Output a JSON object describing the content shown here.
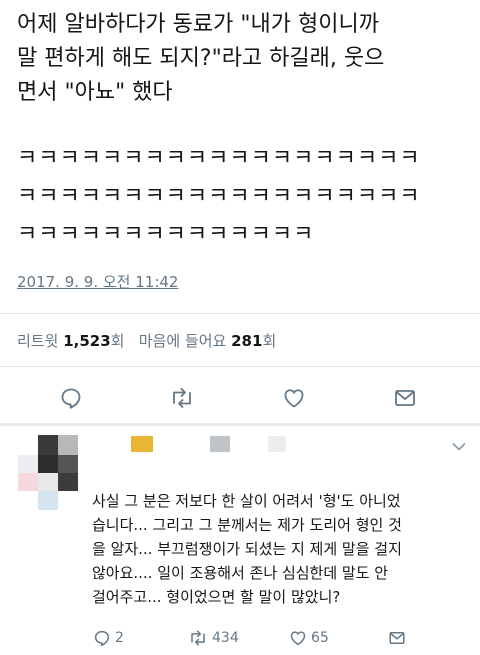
{
  "tweet": {
    "text_lines": [
      "어제 알바하다가 동료가 \"내가 형이니까",
      "말 편하게 해도 되지?\"라고 하길래, 웃으",
      "면서 \"아뇨\" 했다"
    ],
    "laugh_lines": [
      "ㅋㅋㅋㅋㅋㅋㅋㅋㅋㅋㅋㅋㅋㅋㅋㅋㅋㅋㅋ",
      "ㅋㅋㅋㅋㅋㅋㅋㅋㅋㅋㅋㅋㅋㅋㅋㅋㅋㅋㅋ",
      "ㅋㅋㅋㅋㅋㅋㅋㅋㅋㅋㅋㅋㅋㅋ"
    ],
    "timestamp": "2017. 9. 9. 오전 11:42",
    "stats": {
      "retweets_label": "리트윗",
      "retweets_count": "1,523",
      "retweets_unit": "회",
      "likes_label": "마음에 들어요",
      "likes_count": "281",
      "likes_unit": "회"
    },
    "actions": [
      "reply-icon",
      "retweet-icon",
      "like-icon",
      "message-icon"
    ]
  },
  "reply": {
    "text_lines": [
      "사실 그 분은 저보다 한 살이 어려서 '형'도 아니었",
      "습니다... 그리고 그 분께서는 제가 도리어 형인 것",
      "을 알자... 부끄럼쟁이가 되셨는 지 제게 말을 걸지",
      "않아요.... 일이 조용해서 존나 심심한데 말도 안",
      "걸어주고... 형이었으면 할 말이 많았니?"
    ],
    "counts": {
      "replies": "2",
      "retweets": "434",
      "likes": "65"
    }
  },
  "colors": {
    "accent_gray": "#657786",
    "divider": "#e1e8ed",
    "retweet_green": "#17bf63"
  }
}
